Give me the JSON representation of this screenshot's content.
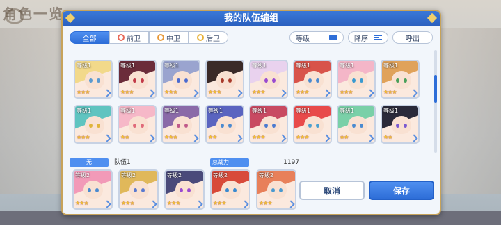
{
  "background": {
    "title": "角色一览"
  },
  "dialog": {
    "title": "我的队伍编组",
    "filters": [
      {
        "label": "全部",
        "active": true
      },
      {
        "label": "前卫",
        "active": false
      },
      {
        "label": "中卫",
        "active": false
      },
      {
        "label": "后卫",
        "active": false
      }
    ],
    "sort_label": "等级",
    "order_label": "降序",
    "call_label": "呼出"
  },
  "roster": {
    "rows": [
      [
        {
          "level": "等级1",
          "stars": "★★★",
          "hair": "#f2d98a",
          "eye": "#5a9ad0"
        },
        {
          "level": "等级1",
          "stars": "★★★",
          "hair": "#6b2c3a",
          "eye": "#c23a48"
        },
        {
          "level": "等级1",
          "stars": "★★★",
          "hair": "#9aa4cf",
          "eye": "#4a6ad0"
        },
        {
          "level": "",
          "stars": "★★★",
          "hair": "#3a2a28",
          "eye": "#a83a2a"
        },
        {
          "level": "等级1",
          "stars": "★★★",
          "hair": "#e9d2ee",
          "eye": "#9a4ad0"
        },
        {
          "level": "等级1",
          "stars": "★★★",
          "hair": "#d8534a",
          "eye": "#4a8ad0"
        },
        {
          "level": "等级1",
          "stars": "★★★",
          "hair": "#f4b6c8",
          "eye": "#3a9ad0"
        },
        {
          "level": "等级1",
          "stars": "★★★",
          "hair": "#e0a25a",
          "eye": "#4aa05a"
        }
      ],
      [
        {
          "level": "等级1",
          "stars": "★★★",
          "hair": "#5fc4c0",
          "eye": "#e0b43a"
        },
        {
          "level": "等级1",
          "stars": "★★",
          "hair": "#f6b8c8",
          "eye": "#e06a7a"
        },
        {
          "level": "等级1",
          "stars": "★★★",
          "hair": "#8a6aa8",
          "eye": "#c05a8a"
        },
        {
          "level": "等级1",
          "stars": "★★",
          "hair": "#5a64c0",
          "eye": "#4a8ad0"
        },
        {
          "level": "等级1",
          "stars": "★★★",
          "hair": "#c84a62",
          "eye": "#4a7ad0"
        },
        {
          "level": "等级1",
          "stars": "★★★",
          "hair": "#e84a4a",
          "eye": "#4aa0d0"
        },
        {
          "level": "等级1",
          "stars": "★★",
          "hair": "#7ad0a8",
          "eye": "#4a8ad0"
        },
        {
          "level": "等级1",
          "stars": "★★",
          "hair": "#2a2a3a",
          "eye": "#7a5ad0"
        }
      ]
    ]
  },
  "team": {
    "tag": "无",
    "name": "队伍1",
    "power_label": "总战力",
    "power_value": "1197",
    "members": [
      {
        "level": "等级2",
        "stars": "★★★",
        "hair": "#f29ab8",
        "eye": "#4a8ad0"
      },
      {
        "level": "等级2",
        "stars": "★★★",
        "hair": "#e0b85a",
        "eye": "#5a7ad0"
      },
      {
        "level": "等级2",
        "stars": "★★★",
        "hair": "#4a4a7a",
        "eye": "#9a4ad0"
      },
      {
        "level": "等级2",
        "stars": "★★★",
        "hair": "#d84a3a",
        "eye": "#3a8ad0"
      },
      {
        "level": "等级2",
        "stars": "★★★",
        "hair": "#e8805a",
        "eye": "#4a9ad0"
      }
    ]
  },
  "buttons": {
    "cancel": "取消",
    "save": "保存"
  }
}
